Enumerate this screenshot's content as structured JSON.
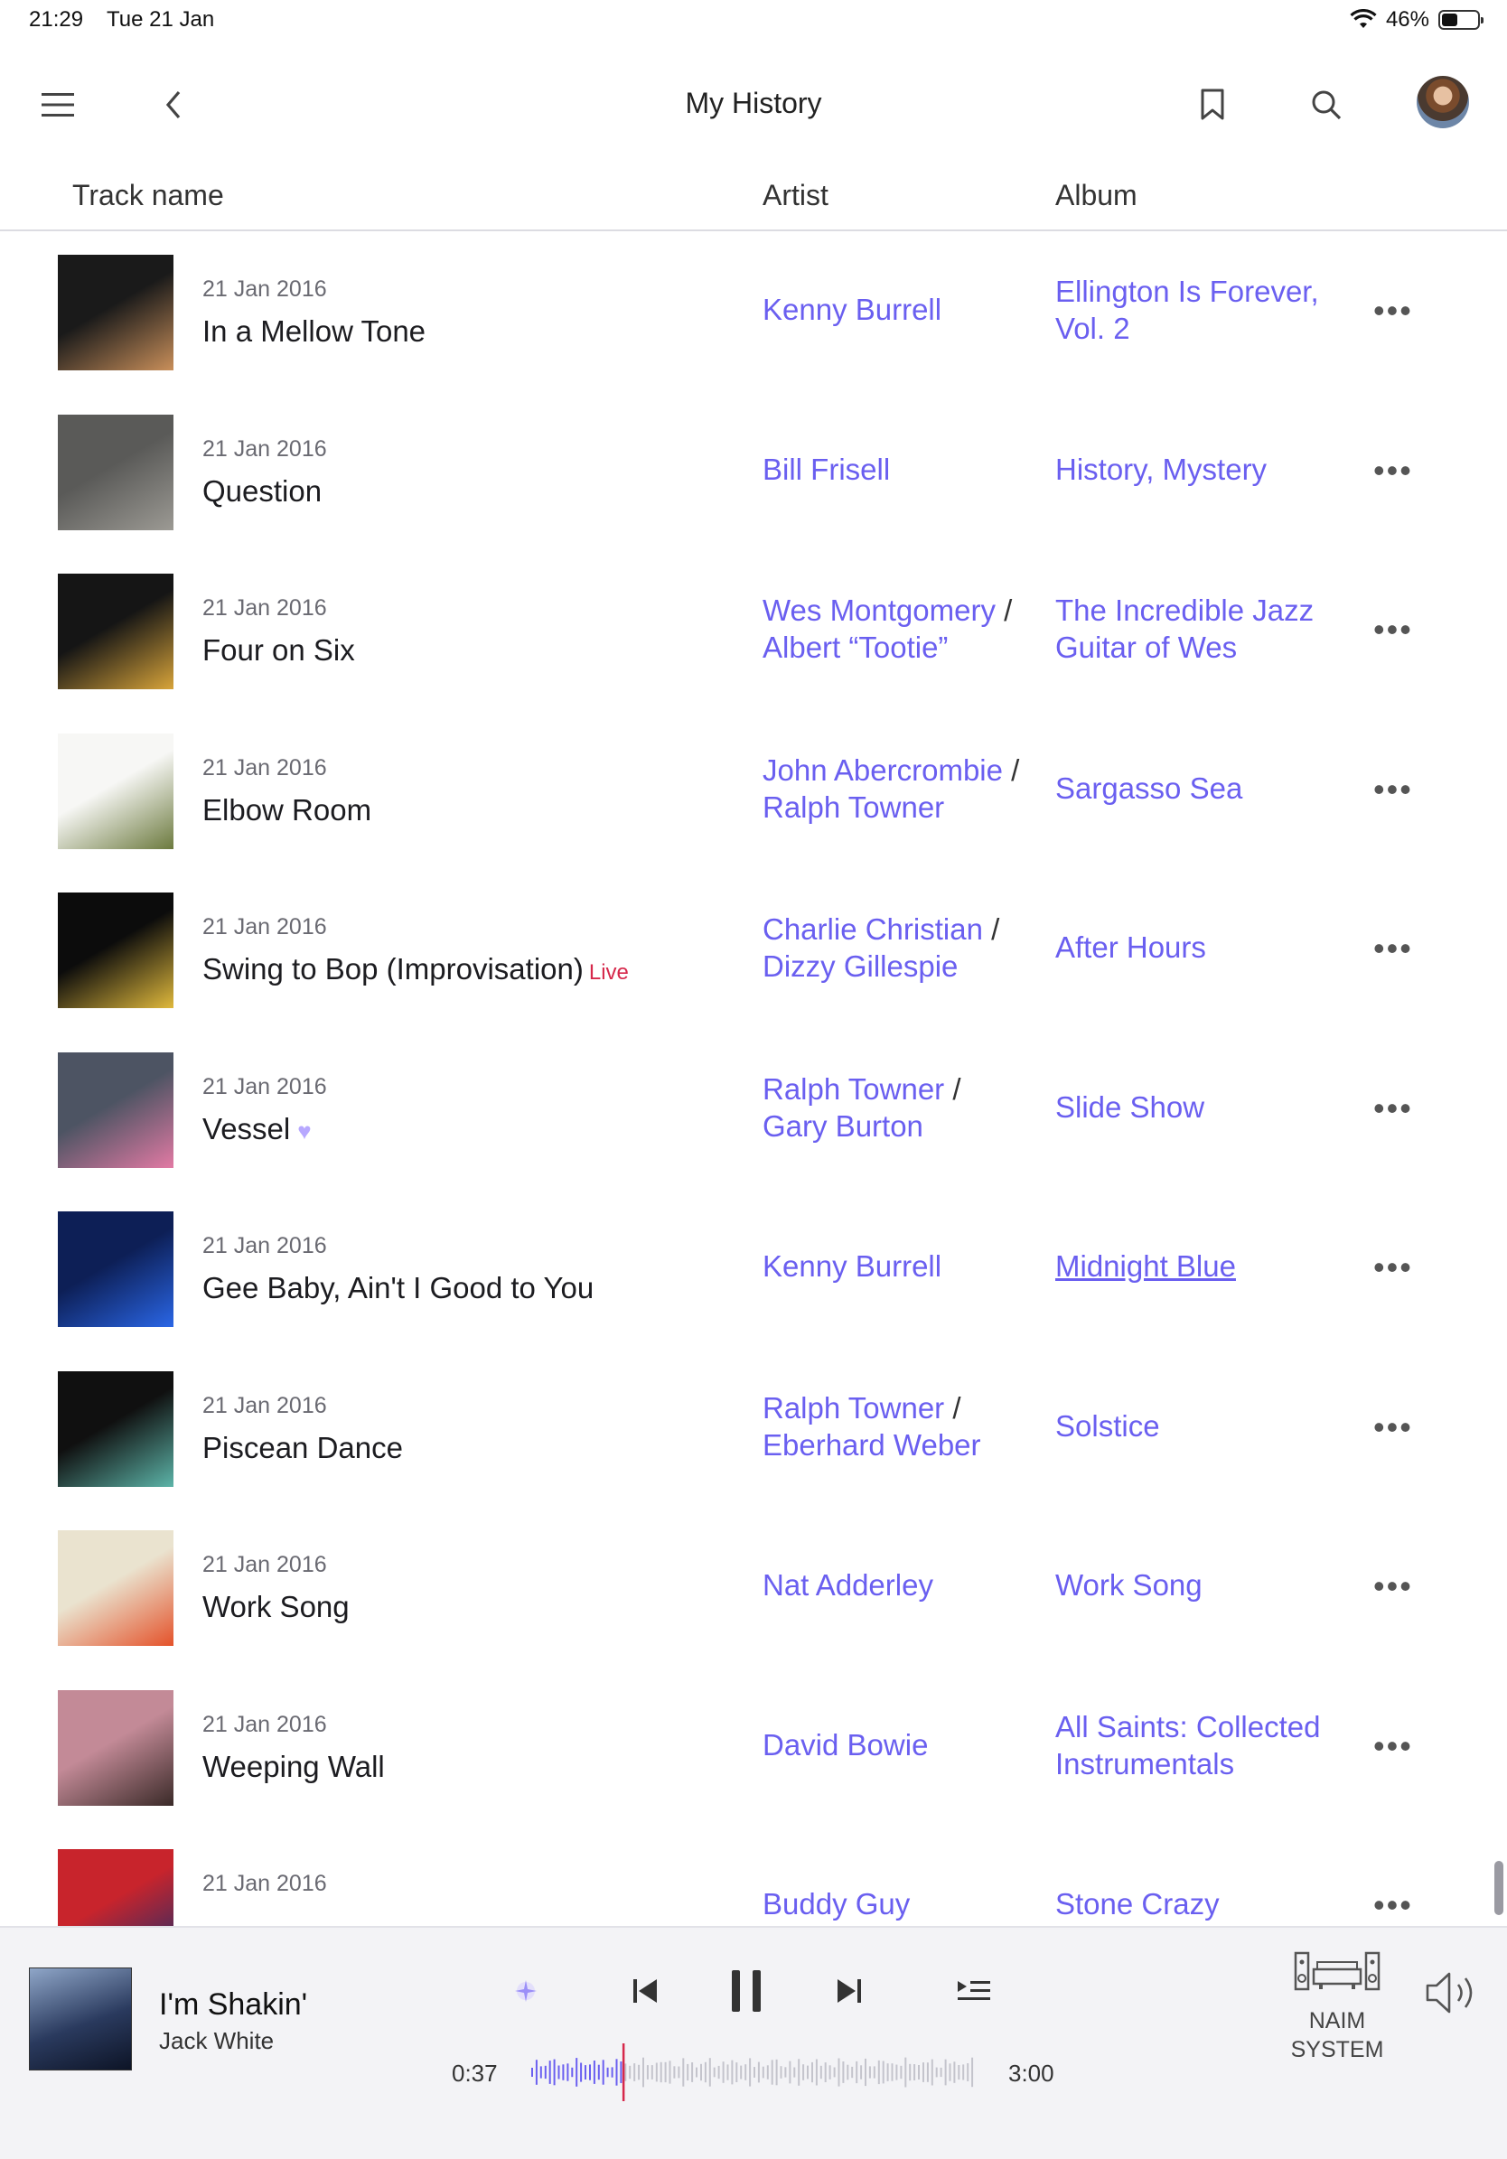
{
  "status_bar": {
    "time": "21:29",
    "date": "Tue 21 Jan",
    "battery_text": "46%",
    "battery_level": 0.46
  },
  "nav": {
    "title": "My History"
  },
  "headers": {
    "track": "Track name",
    "artist": "Artist",
    "album": "Album"
  },
  "rows": [
    {
      "date": "21 Jan 2016",
      "track": "In a Mellow Tone",
      "badge": "",
      "artists": [
        "Kenny Burrell"
      ],
      "album": "Ellington Is Forever, Vol. 2",
      "album_underline": false,
      "cover_colors": [
        "#1a1a1a",
        "#c98f5a"
      ]
    },
    {
      "date": "21 Jan 2016",
      "track": "Question",
      "badge": "",
      "artists": [
        "Bill Frisell"
      ],
      "album": "History, Mystery",
      "album_underline": false,
      "cover_colors": [
        "#5a5a58",
        "#9c9a94"
      ]
    },
    {
      "date": "21 Jan 2016",
      "track": "Four on Six",
      "badge": "",
      "artists": [
        "Wes Montgomery",
        "Albert “Tootie”"
      ],
      "album": "The Incredible Jazz Guitar of Wes",
      "album_underline": false,
      "cover_colors": [
        "#151515",
        "#d8a43a"
      ]
    },
    {
      "date": "21 Jan 2016",
      "track": "Elbow Room",
      "badge": "",
      "artists": [
        "John Abercrombie",
        "Ralph Towner"
      ],
      "album": "Sargasso Sea",
      "album_underline": false,
      "cover_colors": [
        "#f7f7f5",
        "#6c7a3e"
      ]
    },
    {
      "date": "21 Jan 2016",
      "track": "Swing to Bop (Improvisation)",
      "badge": "Live",
      "artists": [
        "Charlie Christian",
        "Dizzy Gillespie"
      ],
      "album": "After Hours",
      "album_underline": false,
      "cover_colors": [
        "#0c0c0c",
        "#e0b93c"
      ]
    },
    {
      "date": "21 Jan 2016",
      "track": "Vessel",
      "badge": "heart",
      "artists": [
        "Ralph Towner",
        "Gary Burton"
      ],
      "album": "Slide Show",
      "album_underline": false,
      "cover_colors": [
        "#4d5463",
        "#e27aa4"
      ]
    },
    {
      "date": "21 Jan 2016",
      "track": "Gee Baby, Ain't I Good to You",
      "badge": "",
      "artists": [
        "Kenny Burrell"
      ],
      "album": "Midnight Blue",
      "album_underline": true,
      "cover_colors": [
        "#0d1f56",
        "#2a66e6"
      ]
    },
    {
      "date": "21 Jan 2016",
      "track": "Piscean Dance",
      "badge": "",
      "artists": [
        "Ralph Towner",
        "Eberhard Weber"
      ],
      "album": "Solstice",
      "album_underline": false,
      "cover_colors": [
        "#101010",
        "#5cb4a8"
      ]
    },
    {
      "date": "21 Jan 2016",
      "track": "Work Song",
      "badge": "",
      "artists": [
        "Nat Adderley"
      ],
      "album": "Work Song",
      "album_underline": false,
      "cover_colors": [
        "#eae3cf",
        "#e4522a"
      ]
    },
    {
      "date": "21 Jan 2016",
      "track": "Weeping Wall",
      "badge": "",
      "artists": [
        "David Bowie"
      ],
      "album": "All Saints: Collected Instrumentals",
      "album_underline": false,
      "cover_colors": [
        "#c38a97",
        "#3a2a28"
      ]
    },
    {
      "date": "21 Jan 2016",
      "track": "",
      "badge": "",
      "artists": [
        "Buddy Guy"
      ],
      "album": "Stone Crazy",
      "album_underline": false,
      "cover_colors": [
        "#c8242c",
        "#1e2d6a"
      ]
    }
  ],
  "player": {
    "title": "I'm Shakin'",
    "artist": "Jack White",
    "elapsed": "0:37",
    "duration": "3:00",
    "progress": 0.205,
    "device_line1": "NAIM",
    "device_line2": "SYSTEM",
    "accent": "#6a5ff0",
    "playhead_color": "#d6284b"
  }
}
